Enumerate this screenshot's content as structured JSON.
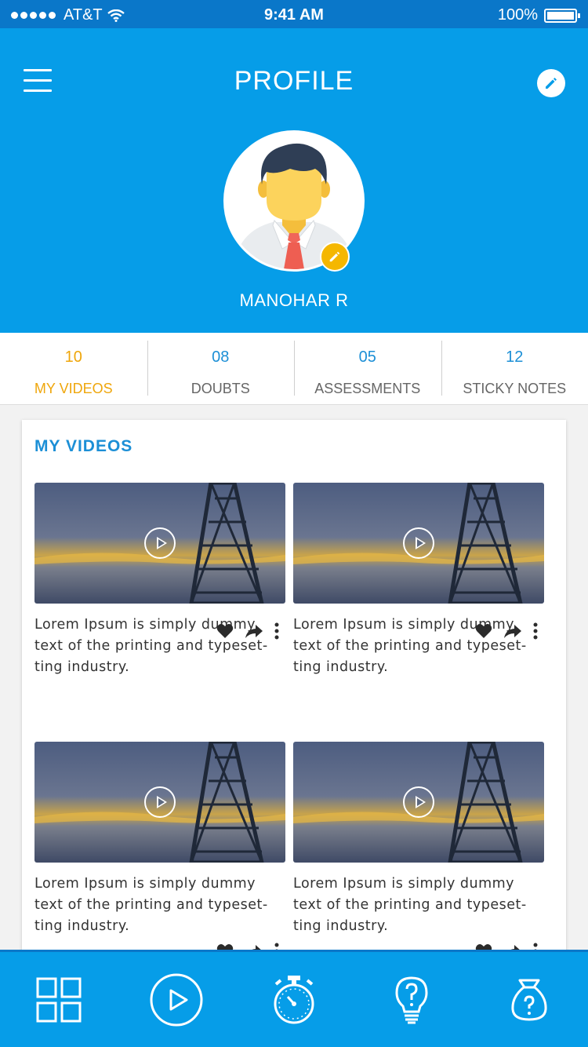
{
  "status_bar": {
    "carrier": "AT&T",
    "time": "9:41 AM",
    "battery": "100%"
  },
  "header": {
    "title": "PROFILE",
    "menu_icon": "hamburger-menu-icon",
    "edit_icon": "pencil-icon"
  },
  "profile": {
    "name": "MANOHAR R",
    "avatar": "male-avatar-with-tie",
    "avatar_edit_icon": "pencil-icon"
  },
  "stats": [
    {
      "count": "10",
      "label": "MY VIDEOS",
      "active": true
    },
    {
      "count": "08",
      "label": "DOUBTS",
      "active": false
    },
    {
      "count": "05",
      "label": "ASSESSMENTS",
      "active": false
    },
    {
      "count": "12",
      "label": "STICKY NOTES",
      "active": false
    }
  ],
  "videos_section": {
    "title": "MY VIDEOS",
    "items": [
      {
        "description": "Lorem Ipsum is simply dummy text of the printing and typeset-ting industry."
      },
      {
        "description": "Lorem Ipsum is simply dummy text of the printing and typeset-ting industry."
      },
      {
        "description": "Lorem Ipsum is simply dummy text of the printing and typeset-ting industry."
      },
      {
        "description": "Lorem Ipsum is simply dummy text of the printing and typeset-ting industry."
      }
    ]
  },
  "bottom_nav": [
    {
      "icon": "grid-icon"
    },
    {
      "icon": "play-circle-icon"
    },
    {
      "icon": "stopwatch-icon"
    },
    {
      "icon": "lightbulb-icon"
    },
    {
      "icon": "question-bag-icon"
    }
  ],
  "colors": {
    "primary": "#069de8",
    "status_bar": "#0a77c9",
    "accent": "#efa60b",
    "link": "#1c8fd6"
  }
}
